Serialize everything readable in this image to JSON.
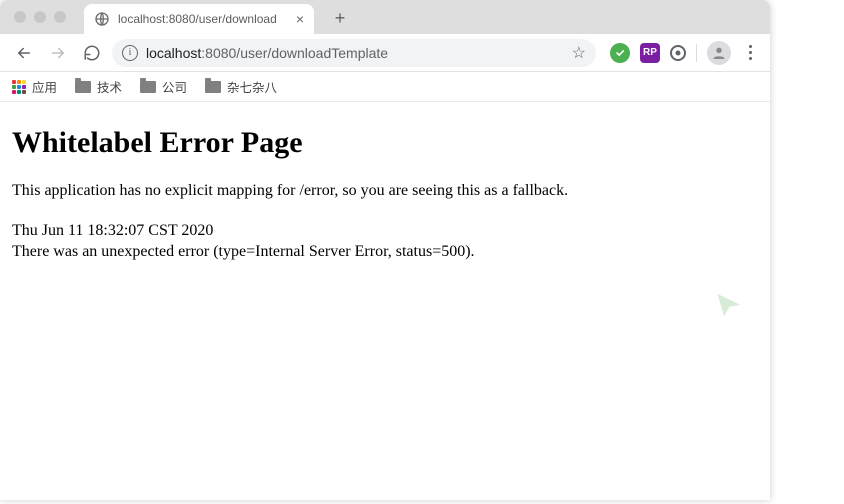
{
  "tab": {
    "title": "localhost:8080/user/download"
  },
  "omnibox": {
    "host": "localhost",
    "port_path": ":8080/user/downloadTemplate"
  },
  "bookmarks": {
    "apps": "应用",
    "items": [
      {
        "label": "技术"
      },
      {
        "label": "公司"
      },
      {
        "label": "杂七杂八"
      }
    ]
  },
  "page": {
    "title": "Whitelabel Error Page",
    "message": "This application has no explicit mapping for /error, so you are seeing this as a fallback.",
    "timestamp": "Thu Jun 11 18:32:07 CST 2020",
    "error_detail": "There was an unexpected error (type=Internal Server Error, status=500)."
  }
}
